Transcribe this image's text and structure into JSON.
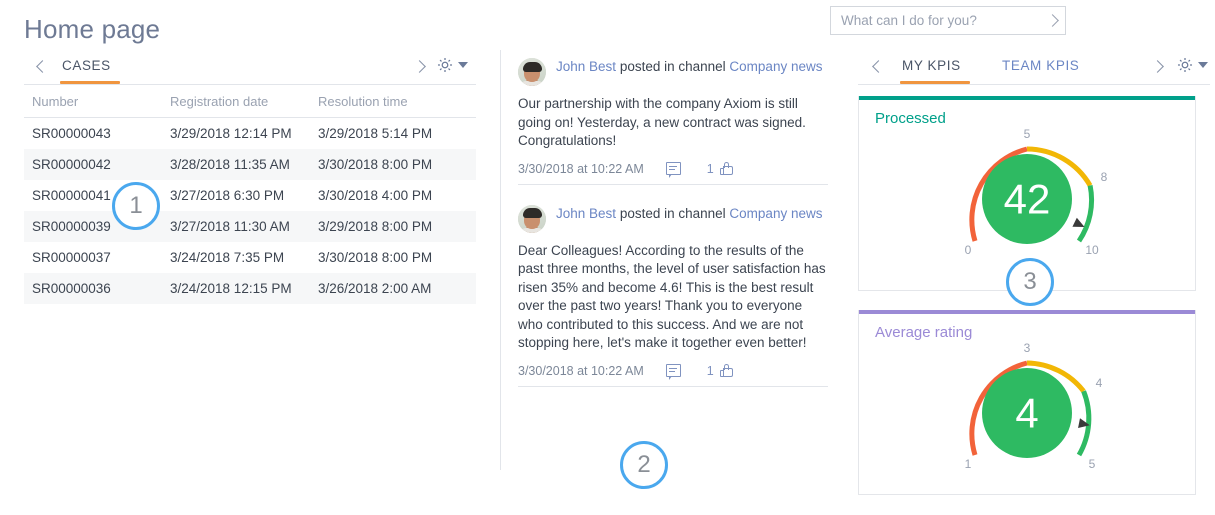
{
  "page": {
    "title": "Home page"
  },
  "cases_panel": {
    "tabs": [
      {
        "label": "CASES",
        "active": true
      }
    ],
    "nav_prev_icon": "chevron-left-icon",
    "nav_next_icon": "chevron-right-icon",
    "settings_icon": "gear-icon",
    "settings_caret_icon": "caret-down-icon",
    "columns": [
      "Number",
      "Registration date",
      "Resolution time"
    ],
    "rows": [
      [
        "SR00000043",
        "3/29/2018 12:14 PM",
        "3/29/2018 5:14 PM"
      ],
      [
        "SR00000042",
        "3/28/2018 11:35 AM",
        "3/30/2018 8:00 PM"
      ],
      [
        "SR00000041",
        "3/27/2018 6:30 PM",
        "3/30/2018 4:00 PM"
      ],
      [
        "SR00000039",
        "3/27/2018 11:30 AM",
        "3/29/2018 8:00 PM"
      ],
      [
        "SR00000037",
        "3/24/2018 7:35 PM",
        "3/30/2018 8:00 PM"
      ],
      [
        "SR00000036",
        "3/24/2018 12:15 PM",
        "3/26/2018 2:00 AM"
      ]
    ]
  },
  "feed": {
    "posts": [
      {
        "author": "John Best",
        "action": "posted in channel",
        "channel": "Company news",
        "body": "Our partnership with the company Axiom is still going on! Yesterday, a new contract was signed. Congratulations!",
        "date": "3/30/2018 at 10:22 AM",
        "comment_icon": "comment-icon",
        "like_count": "1",
        "like_icon": "thumbs-up-icon",
        "avatar_icon": "user-avatar"
      },
      {
        "author": "John Best",
        "action": "posted in channel",
        "channel": "Company news",
        "body": "Dear Colleagues! According to the results of the past three months, the level of user satisfaction has risen 35% and become 4.6! This is the best result over the past two years! Thank you to everyone who contributed to this success. And we are not stopping here, let's make it together even better!",
        "date": "3/30/2018 at 10:22 AM",
        "comment_icon": "comment-icon",
        "like_count": "1",
        "like_icon": "thumbs-up-icon",
        "avatar_icon": "user-avatar"
      }
    ]
  },
  "search": {
    "placeholder": "What can I do for you?",
    "submit_icon": "chevron-right-icon"
  },
  "kpi_panel": {
    "tabs": [
      {
        "label": "MY KPIS",
        "active": true
      },
      {
        "label": "TEAM KPIS",
        "active": false
      }
    ],
    "nav_prev_icon": "chevron-left-icon",
    "nav_next_icon": "chevron-right-icon",
    "settings_icon": "gear-icon",
    "settings_caret_icon": "caret-down-icon"
  },
  "chart_data": [
    {
      "type": "gauge",
      "title": "Processed",
      "value": 42,
      "value_label": "42",
      "tick_labels": [
        "0",
        "5",
        "8",
        "10"
      ],
      "min": 0,
      "max": 10,
      "needle_value": 8.6,
      "accent_color": "#00a08a",
      "title_color": "#00a08a",
      "center_color": "#2eba62",
      "bands": [
        {
          "from": 0,
          "to": 5,
          "color": "#f2633a"
        },
        {
          "from": 5,
          "to": 8,
          "color": "#f2b705"
        },
        {
          "from": 8,
          "to": 10,
          "color": "#2eba62"
        }
      ]
    },
    {
      "type": "gauge",
      "title": "Average rating",
      "value": 4,
      "value_label": "4",
      "tick_labels": [
        "1",
        "3",
        "4",
        "5"
      ],
      "min": 1,
      "max": 5,
      "needle_value": 4.0,
      "accent_color": "#9b8ad6",
      "title_color": "#9b8ad6",
      "center_color": "#2eba62",
      "bands": [
        {
          "from": 1,
          "to": 3,
          "color": "#f2633a"
        },
        {
          "from": 3,
          "to": 4,
          "color": "#f2b705"
        },
        {
          "from": 4,
          "to": 5,
          "color": "#2eba62"
        }
      ]
    }
  ],
  "callouts": [
    {
      "label": "1"
    },
    {
      "label": "2"
    },
    {
      "label": "3"
    }
  ]
}
